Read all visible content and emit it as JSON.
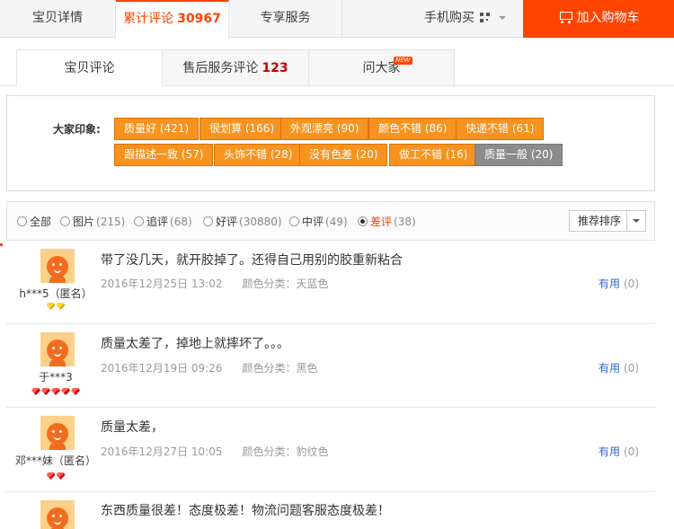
{
  "top_tabs": {
    "detail": "宝贝详情",
    "reviews_label": "累计评论",
    "reviews_count": "30967",
    "service": "专享服务",
    "mobile_buy": "手机购买",
    "add_to_cart": "加入购物车"
  },
  "sub_tabs": {
    "item_reviews": "宝贝评论",
    "aftersale_label": "售后服务评论",
    "aftersale_count": "123",
    "ask": "问大家",
    "new_badge": "NEW"
  },
  "impression": {
    "label": "大家印象:",
    "tags": [
      "质量好 (421)",
      "很划算 (166)",
      "外观漂亮 (90)",
      "颜色不错 (86)",
      "快递不错 (61)",
      "跟描述一致 (57)",
      "头饰不错 (28)",
      "没有色差 (20)",
      "做工不错 (16)",
      "质量一般 (20)"
    ]
  },
  "filter": {
    "options": [
      {
        "label": "全部",
        "count": ""
      },
      {
        "label": "图片",
        "count": "(215)"
      },
      {
        "label": "追评",
        "count": "(68)"
      },
      {
        "label": "好评",
        "count": "(30880)"
      },
      {
        "label": "中评",
        "count": "(49)"
      },
      {
        "label": "差评",
        "count": "(38)"
      }
    ],
    "selected": "差评",
    "sort_label": "推荐排序"
  },
  "reviews": [
    {
      "user": "h***5（匿名）",
      "text": "带了没几天，就开胶掉了。还得自己用别的胶重新粘合",
      "date": "2016年12月25日 13:02",
      "color": "颜色分类：天蓝色",
      "useful": "有用",
      "useful_count": "(0)",
      "gem_type": "yellow",
      "gems": 2
    },
    {
      "user": "于***3",
      "text": "质量太差了，掉地上就摔坏了。。。",
      "date": "2016年12月19日 09:26",
      "color": "颜色分类：黑色",
      "useful": "有用",
      "useful_count": "(0)",
      "gem_type": "red",
      "gems": 5
    },
    {
      "user": "邓***妹（匿名）",
      "text": "质量太差，",
      "date": "2016年12月27日 10:05",
      "color": "颜色分类：豹纹色",
      "useful": "有用",
      "useful_count": "(0)",
      "gem_type": "red",
      "gems": 2
    },
    {
      "user": "",
      "text": "东西质量很差！态度极差！物流问题客服态度极差！",
      "date": "",
      "color": "",
      "useful": "",
      "useful_count": "",
      "gem_type": "",
      "gems": 0
    }
  ],
  "colors": {
    "accent": "#ff4400",
    "tag_orange": "#f7931e",
    "tag_gray": "#8c8c8c",
    "link": "#3366cc"
  }
}
